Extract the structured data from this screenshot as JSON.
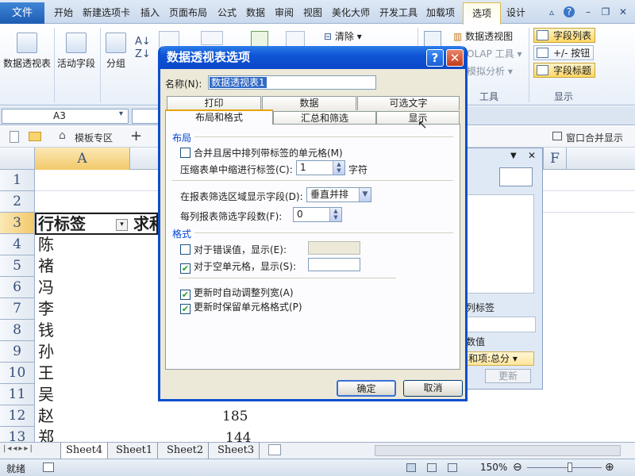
{
  "ribbon_tabs": [
    "文件",
    "开始",
    "新建选项卡",
    "插入",
    "页面布局",
    "公式",
    "数据",
    "审阅",
    "视图",
    "美化大师",
    "开发工具",
    "加载项",
    "选项",
    "设计"
  ],
  "ribbon_buttons": {
    "pivot_table": "数据透视表",
    "active_field": "活动字段",
    "group": "分组",
    "clear": "清除",
    "pivot_chart": "数据透视图",
    "olap_tools": "OLAP 工具",
    "what_if": "模拟分析",
    "field_list": "字段列表",
    "plus_minus": "+/- 按钮",
    "field_headers": "字段标题",
    "group_tools": "工具",
    "group_show": "显示"
  },
  "name_box": "A3",
  "quick_row": {
    "template": "模板专区",
    "merge": "窗口合并显示"
  },
  "columns": [
    "A",
    "F"
  ],
  "rows": [
    {
      "n": "1",
      "a": ""
    },
    {
      "n": "2",
      "a": ""
    },
    {
      "n": "3",
      "a": "行标签"
    },
    {
      "n": "4",
      "a": "陈"
    },
    {
      "n": "5",
      "a": "褚"
    },
    {
      "n": "6",
      "a": "冯"
    },
    {
      "n": "7",
      "a": "李"
    },
    {
      "n": "8",
      "a": "钱"
    },
    {
      "n": "9",
      "a": "孙"
    },
    {
      "n": "10",
      "a": "王"
    },
    {
      "n": "11",
      "a": "吴"
    },
    {
      "n": "12",
      "a": "赵"
    },
    {
      "n": "13",
      "a": "郑"
    }
  ],
  "cell_b3": "求和",
  "cell_c12": "185",
  "cell_c13": "144",
  "pane": {
    "col_label": "列标签",
    "values": "数值",
    "sum_item": "和项:总分",
    "refresh": "更新"
  },
  "dialog": {
    "title": "数据透视表选项",
    "name_label": "名称(N):",
    "name_value": "数据透视表1",
    "tabs_top": [
      "打印",
      "数据",
      "可选文字"
    ],
    "tabs_bottom": [
      "布局和格式",
      "汇总和筛选",
      "显示"
    ],
    "section_layout": "布局",
    "merge_center": "合并且居中排列带标签的单元格(M)",
    "indent_label": "压缩表单中缩进行标签(C):",
    "indent_value": "1",
    "indent_unit": "字符",
    "filter_area_label": "在报表筛选区域显示字段(D):",
    "filter_area_value": "垂直并排",
    "filter_count_label": "每列报表筛选字段数(F):",
    "filter_count_value": "0",
    "section_format": "格式",
    "error_label": "对于错误值，显示(E):",
    "empty_label": "对于空单元格，显示(S):",
    "autofit": "更新时自动调整列宽(A)",
    "preserve": "更新时保留单元格格式(P)",
    "ok": "确定",
    "cancel": "取消"
  },
  "sheets": [
    "Sheet4",
    "Sheet1",
    "Sheet2",
    "Sheet3"
  ],
  "status": {
    "ready": "就绪",
    "zoom": "150%"
  }
}
